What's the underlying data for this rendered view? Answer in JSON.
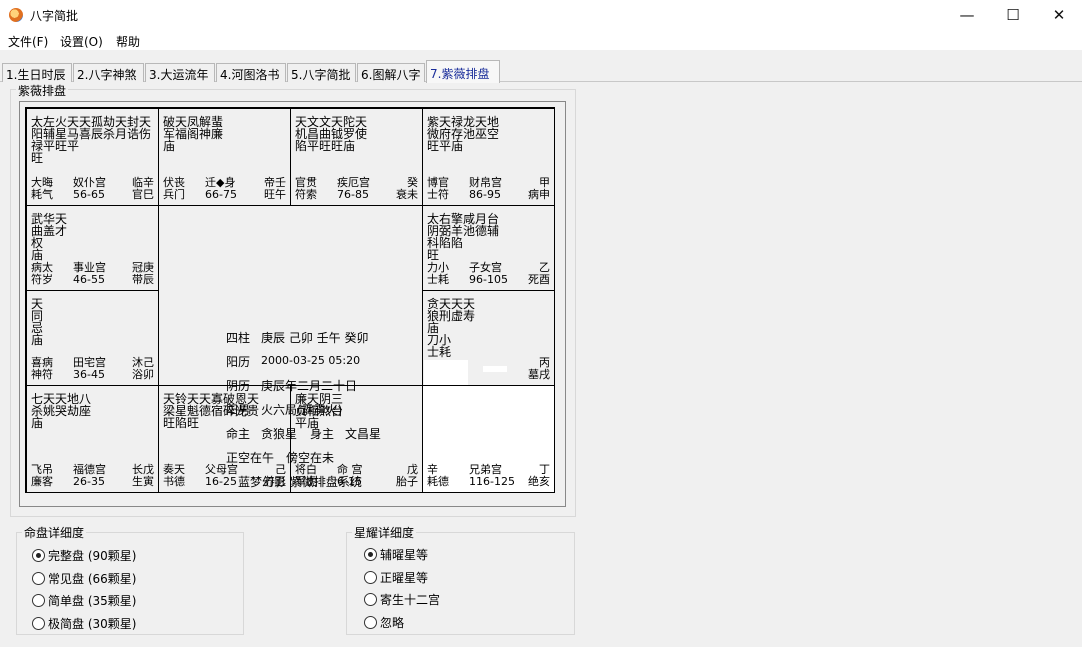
{
  "window": {
    "title": "八字简批",
    "minimize": "—",
    "maximize": "☐",
    "close": "✕"
  },
  "menu": [
    "文件(F)",
    "设置(O)",
    "帮助"
  ],
  "tabs": [
    "1.生日时辰",
    "2.八字神煞",
    "3.大运流年",
    "4.河图洛书",
    "5.八字简批",
    "6.图解八字",
    "7.紫薇排盘"
  ],
  "active_tab": 6,
  "board_title": "紫薇排盘",
  "palaces": [
    {
      "stars": "太左火天天孤劫天封天\n阳辅星马喜辰杀月诰伤\n禄平旺平\n旺",
      "r1": [
        "大晦",
        "奴仆宫",
        "临辛"
      ],
      "r2": [
        "耗气",
        "56-65",
        "官巳"
      ]
    },
    {
      "stars": "破天凤解蜚\n军福阁神廉\n庙",
      "r1": [
        "伏丧",
        "迁◆身",
        "帝壬"
      ],
      "r2": [
        "兵门",
        "66-75",
        "旺午"
      ]
    },
    {
      "stars": "天文文天陀天\n机昌曲钺罗使\n陷平旺旺庙",
      "r1": [
        "官贯",
        "疾厄宫",
        "癸"
      ],
      "r2": [
        "符索",
        "76-85",
        "衰未"
      ]
    },
    {
      "stars": "紫天禄龙天地\n微府存池巫空\n旺平庙",
      "r1": [
        "博官",
        "财帛宫",
        "甲"
      ],
      "r2": [
        "士符",
        "86-95",
        "病申"
      ]
    },
    {
      "stars": "武华天\n曲盖才\n权\n庙",
      "r1": [
        "病太",
        "事业宫",
        "冠庚"
      ],
      "r2": [
        "符岁",
        "46-55",
        "带辰"
      ]
    },
    {
      "stars": "太右擎咸月台\n阴弼羊池德辅\n科陷陷\n旺",
      "r1": [
        "力小",
        "子女宫",
        "乙"
      ],
      "r2": [
        "士耗",
        "96-105",
        "死酉"
      ]
    },
    {
      "stars": "天\n同\n忌\n庙",
      "r1": [
        "喜病",
        "田宅宫",
        "沐己"
      ],
      "r2": [
        "神符",
        "36-45",
        "浴卯"
      ]
    },
    {
      "stars": "贪天天天\n狼刑虚寿\n庙\n刀小\n士耗",
      "r1": [
        "",
        "",
        "丙"
      ],
      "r2": [
        "",
        "",
        "墓戌"
      ]
    },
    {
      "stars": "七天天地八\n杀姚哭劫座\n庙",
      "r1": [
        "飞吊",
        "福德宫",
        "长戊"
      ],
      "r2": [
        "廉客",
        "26-35",
        "生寅"
      ]
    },
    {
      "stars": "天铃天天寡破恩天\n梁星魁德宿碎光贵\n旺陷旺",
      "r1": [
        "奏天",
        "父母宫",
        "己"
      ],
      "r2": [
        "书德",
        "16-25",
        "养丑"
      ]
    },
    {
      "stars": "廉天阴三\n贞相煞台\n平庙",
      "r1": [
        "将白",
        "命 宫",
        "戊"
      ],
      "r2": [
        "军虎",
        "6-15",
        "胎子"
      ]
    },
    {
      "stars": "",
      "r1": [
        "辛",
        "兄弟宫",
        "丁"
      ],
      "r2": [
        "耗德",
        "116-125",
        "绝亥"
      ]
    }
  ],
  "center": {
    "sizhu_label": "四柱",
    "sizhu": "庚辰  己卯  壬午  癸卯",
    "solar_label": "阳历",
    "solar": "2000-03-25 05:20",
    "lunar_label": "阴历",
    "lunar": "庚辰年二月二十日",
    "gender_label": "阳男",
    "ju": "火六局(霹雳火)",
    "mingzhu_label": "命主",
    "mingzhu": "贪狼星",
    "shenzhu_label": "身主",
    "shenzhu": "文昌星",
    "kong": "正空在午",
    "pang": "傍空在未",
    "brand": "蓝梦幻影  紫微排盘系统"
  },
  "detail_group": {
    "title": "命盘详细度",
    "options": [
      "完整盘 (90颗星)",
      "常见盘 (66颗星)",
      "简单盘 (35颗星)",
      "极简盘 (30颗星)"
    ],
    "selected": 0
  },
  "star_group": {
    "title": "星耀详细度",
    "options": [
      "辅曜星等",
      "正曜星等",
      "寄生十二宫",
      "忽略"
    ],
    "selected": 0
  }
}
